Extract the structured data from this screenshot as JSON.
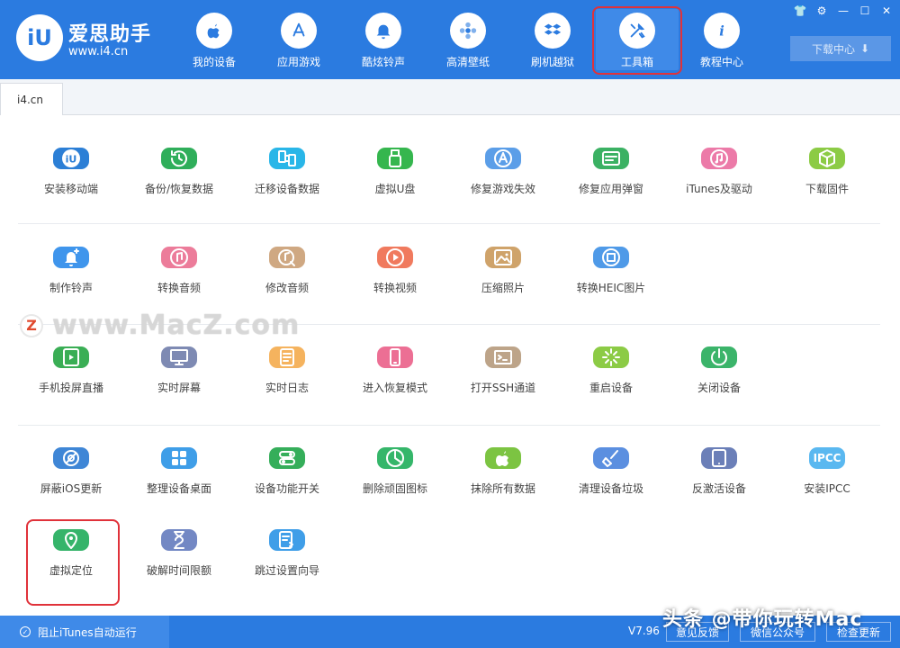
{
  "brand": {
    "logo_text": "iU",
    "name": "爱思助手",
    "url": "www.i4.cn"
  },
  "nav": [
    {
      "label": "我的设备",
      "icon": "apple-icon"
    },
    {
      "label": "应用游戏",
      "icon": "app-store-icon"
    },
    {
      "label": "酷炫铃声",
      "icon": "bell-icon"
    },
    {
      "label": "高清壁纸",
      "icon": "flower-icon"
    },
    {
      "label": "刷机越狱",
      "icon": "dropbox-box-icon"
    },
    {
      "label": "工具箱",
      "icon": "tools-icon",
      "active": true
    },
    {
      "label": "教程中心",
      "icon": "info-icon"
    }
  ],
  "window_controls": [
    "shirt-icon",
    "gear-icon",
    "minimize-icon",
    "maximize-icon",
    "close-icon"
  ],
  "download_center": {
    "label": "下载中心",
    "icon": "download-arrow-icon"
  },
  "tab": {
    "label": "i4.cn"
  },
  "tools": [
    {
      "label": "安装移动端",
      "icon": "i4-app-icon",
      "color": "#2c7fd6"
    },
    {
      "label": "备份/恢复数据",
      "icon": "backup-clock-icon",
      "color": "#2fae5a"
    },
    {
      "label": "迁移设备数据",
      "icon": "migrate-phones-icon",
      "color": "#29b6e8"
    },
    {
      "label": "虚拟U盘",
      "icon": "usb-drive-icon",
      "color": "#35b64e"
    },
    {
      "label": "修复游戏失效",
      "icon": "app-store-repair-icon",
      "color": "#5b9ee8"
    },
    {
      "label": "修复应用弹窗",
      "icon": "apple-id-icon",
      "color": "#3bb163"
    },
    {
      "label": "iTunes及驱动",
      "icon": "music-note-icon",
      "color": "#ec7aa8"
    },
    {
      "label": "下载固件",
      "icon": "cube-icon",
      "color": "#8ccb45"
    },
    {
      "label": "制作铃声",
      "icon": "bell-add-icon",
      "color": "#3f95ec"
    },
    {
      "label": "转换音频",
      "icon": "music-convert-icon",
      "color": "#ec7c9a"
    },
    {
      "label": "修改音频",
      "icon": "music-edit-icon",
      "color": "#cfa882"
    },
    {
      "label": "转换视频",
      "icon": "play-icon",
      "color": "#f07a5e"
    },
    {
      "label": "压缩照片",
      "icon": "photo-icon",
      "color": "#cfa36a"
    },
    {
      "label": "转换HEIC图片",
      "icon": "photo-convert-icon",
      "color": "#4f9ae8"
    },
    {
      "label": "手机投屏直播",
      "icon": "screen-cast-icon",
      "color": "#3aae55"
    },
    {
      "label": "实时屏幕",
      "icon": "monitor-icon",
      "color": "#7e8ab3"
    },
    {
      "label": "实时日志",
      "icon": "document-icon",
      "color": "#f5b35e"
    },
    {
      "label": "进入恢复模式",
      "icon": "phone-icon",
      "color": "#ec6f94"
    },
    {
      "label": "打开SSH通道",
      "icon": "terminal-icon",
      "color": "#bda489"
    },
    {
      "label": "重启设备",
      "icon": "loading-star-icon",
      "color": "#8ccb45"
    },
    {
      "label": "关闭设备",
      "icon": "power-icon",
      "color": "#3bb46a"
    },
    {
      "label": "屏蔽iOS更新",
      "icon": "gear-block-icon",
      "color": "#3f86d6"
    },
    {
      "label": "整理设备桌面",
      "icon": "grid-icon",
      "color": "#3f9ee8"
    },
    {
      "label": "设备功能开关",
      "icon": "toggle-icon",
      "color": "#35ae5a"
    },
    {
      "label": "删除顽固图标",
      "icon": "pie-icon",
      "color": "#35b66a"
    },
    {
      "label": "抹除所有数据",
      "icon": "apple-erase-icon",
      "color": "#7cc442"
    },
    {
      "label": "清理设备垃圾",
      "icon": "broom-icon",
      "color": "#5b8fe0"
    },
    {
      "label": "反激活设备",
      "icon": "tablet-icon",
      "color": "#6b7fb8"
    },
    {
      "label": "安装IPCC",
      "icon": "ipcc-icon",
      "color": "#5ab8f0",
      "tile_text": "IPCC"
    },
    {
      "label": "虚拟定位",
      "icon": "location-pin-icon",
      "color": "#35b46a",
      "highlight": true
    },
    {
      "label": "破解时间限额",
      "icon": "hourglass-icon",
      "color": "#7388c4"
    },
    {
      "label": "跳过设置向导",
      "icon": "skip-list-icon",
      "color": "#3f9ee8"
    }
  ],
  "watermark": {
    "badge": "Z",
    "text": "www.MacZ.com"
  },
  "footer": {
    "block_itunes_label": "阻止iTunes自动运行",
    "version": "V7.96",
    "buttons": [
      "意见反馈",
      "微信公众号",
      "检查更新"
    ],
    "overlay_text": "头条 @带你玩转Mac"
  }
}
